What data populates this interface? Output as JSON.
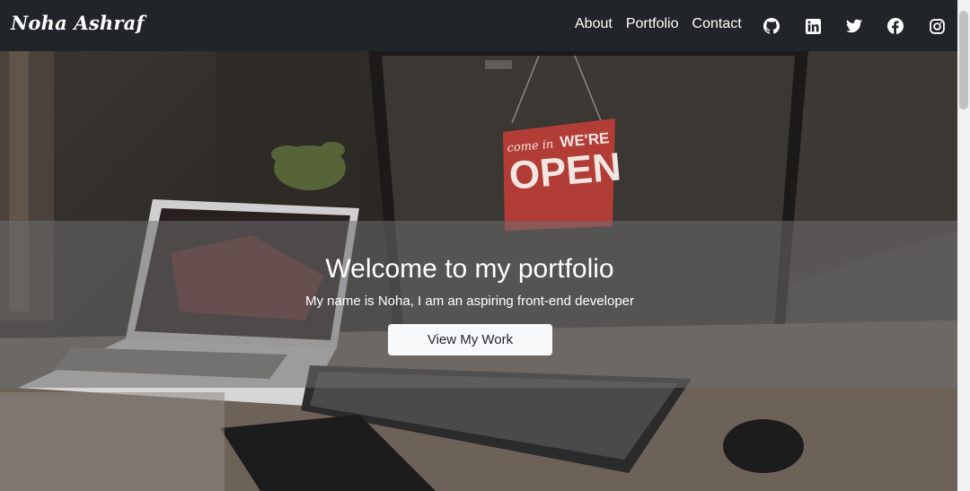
{
  "navbar": {
    "brand": "Noha Ashraf",
    "links": [
      "About",
      "Portfolio",
      "Contact"
    ],
    "socials": [
      "github-icon",
      "linkedin-icon",
      "twitter-icon",
      "facebook-icon",
      "instagram-icon"
    ]
  },
  "hero": {
    "title": "Welcome to my portfolio",
    "subtitle": "My name is Noha, I am an aspiring front-end developer",
    "button_label": "View My Work",
    "sign": {
      "line1": "come in",
      "line2": "WE'RE",
      "line3": "OPEN"
    }
  },
  "colors": {
    "navbar_bg": "#212529",
    "button_bg": "#f8f9fa",
    "sign_red": "#c8443c"
  }
}
